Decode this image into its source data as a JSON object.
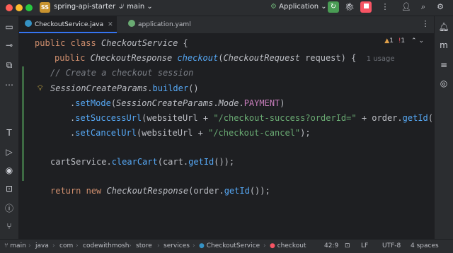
{
  "titlebar": {
    "project_badge": "SS",
    "project_name": "spring-api-starter",
    "branch": "main",
    "run_config": "Application",
    "colors": {
      "close": "#ff5f57",
      "minimize": "#febc2e",
      "maximize": "#28c840",
      "run": "#499c54",
      "stop": "#f75464"
    }
  },
  "tabs": [
    {
      "label": "CheckoutService.java",
      "active": true
    },
    {
      "label": "application.yaml",
      "active": false
    }
  ],
  "editor": {
    "inspection": {
      "warnings": "1",
      "errors": "1"
    },
    "lines": {
      "class_decl": {
        "kw1": "public",
        "kw2": "class",
        "name": "CheckoutService",
        "brace": " {"
      },
      "method_decl": {
        "kw": "public",
        "ret": "CheckoutResponse",
        "name": "checkout",
        "open": "(",
        "ptype": "CheckoutRequest",
        "pname": "request",
        "close": ") {",
        "usages": "1 usage"
      },
      "comment": "// Create a checkout session",
      "builder": {
        "cls": "SessionCreateParams",
        "dot": ".",
        "meth": "builder",
        "tail": "()"
      },
      "set_mode": {
        "dot": ".",
        "meth": "setMode",
        "open": "(",
        "cls": "SessionCreateParams",
        "dot2": ".",
        "cls2": "Mode",
        "dot3": ".",
        "val": "PAYMENT",
        "close": ")"
      },
      "set_success": {
        "dot": ".",
        "meth": "setSuccessUrl",
        "open": "(websiteUrl + ",
        "str": "\"/checkout-success?orderId=\"",
        "mid": " + order.",
        "meth2": "getId",
        "tail": "()"
      },
      "set_cancel": {
        "dot": ".",
        "meth": "setCancelUrl",
        "open": "(websiteUrl + ",
        "str": "\"/checkout-cancel\"",
        "close": ");"
      },
      "clear_cart": {
        "obj": "cartService.",
        "meth": "clearCart",
        "mid": "(cart.",
        "meth2": "getId",
        "tail": "());"
      },
      "return_stmt": {
        "kw1": "return",
        "kw2": "new",
        "cls": "CheckoutResponse",
        "mid": "(order.",
        "meth": "getId",
        "tail": "());"
      }
    }
  },
  "breadcrumbs": [
    "main",
    "java",
    "com",
    "codewithmosh",
    "store",
    "services",
    "CheckoutService",
    "checkout"
  ],
  "status": {
    "position": "42:9",
    "line_sep": "LF",
    "encoding": "UTF-8",
    "indent": "4 spaces"
  }
}
